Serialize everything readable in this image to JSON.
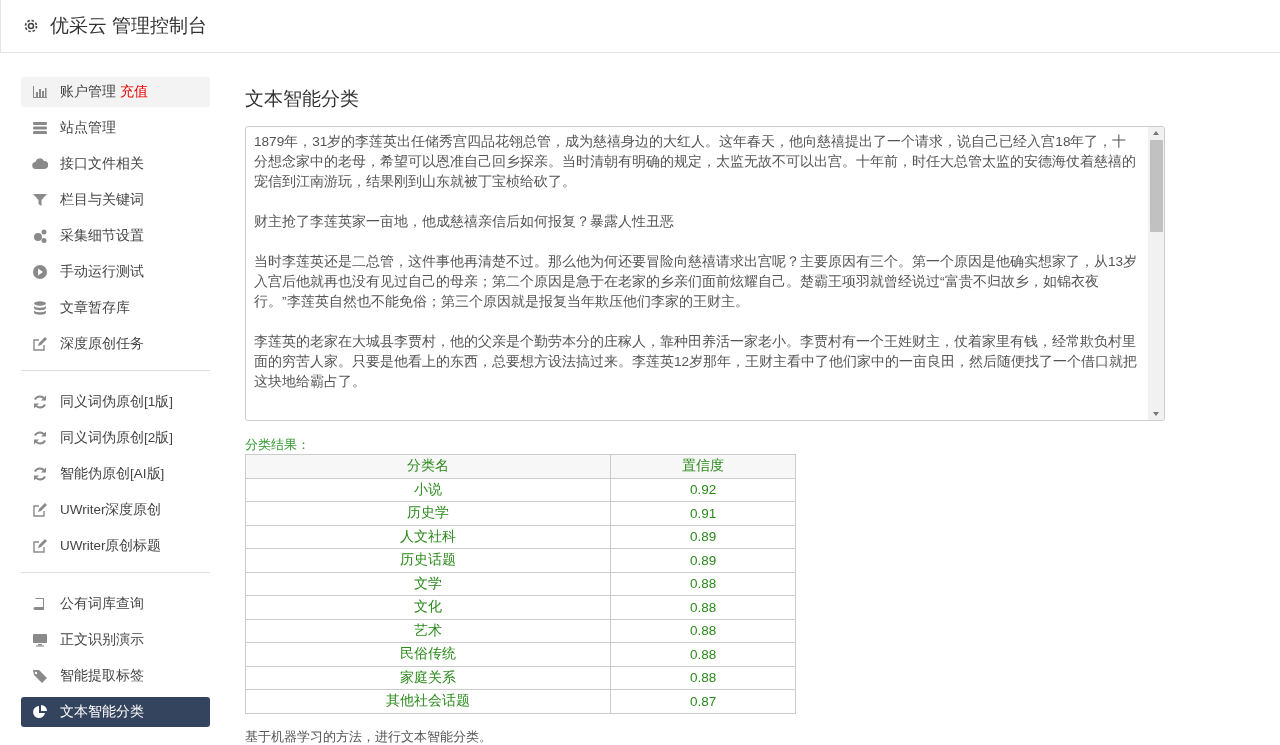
{
  "header": {
    "title": "优采云 管理控制台"
  },
  "sidebar": {
    "groups": [
      {
        "items": [
          {
            "label": "账户管理",
            "badge": "充值",
            "hovered": true,
            "selected": false
          },
          {
            "label": "站点管理",
            "hovered": false,
            "selected": false
          },
          {
            "label": "接口文件相关",
            "hovered": false,
            "selected": false
          },
          {
            "label": "栏目与关键词",
            "hovered": false,
            "selected": false
          },
          {
            "label": "采集细节设置",
            "hovered": false,
            "selected": false
          },
          {
            "label": "手动运行测试",
            "hovered": false,
            "selected": false
          },
          {
            "label": "文章暂存库",
            "hovered": false,
            "selected": false
          },
          {
            "label": "深度原创任务",
            "hovered": false,
            "selected": false
          }
        ]
      },
      {
        "items": [
          {
            "label": "同义词伪原创[1版]",
            "hovered": false,
            "selected": false
          },
          {
            "label": "同义词伪原创[2版]",
            "hovered": false,
            "selected": false
          },
          {
            "label": "智能伪原创[AI版]",
            "hovered": false,
            "selected": false
          },
          {
            "label": "UWriter深度原创",
            "hovered": false,
            "selected": false
          },
          {
            "label": "UWriter原创标题",
            "hovered": false,
            "selected": false
          }
        ]
      },
      {
        "items": [
          {
            "label": "公有词库查询",
            "hovered": false,
            "selected": false
          },
          {
            "label": "正文识别演示",
            "hovered": false,
            "selected": false
          },
          {
            "label": "智能提取标签",
            "hovered": false,
            "selected": false
          },
          {
            "label": "文本智能分类",
            "hovered": false,
            "selected": true
          }
        ]
      }
    ]
  },
  "main": {
    "title": "文本智能分类",
    "input_text": [
      "1879年，31岁的李莲英出任储秀宫四品花翎总管，成为慈禧身边的大红人。这年春天，他向慈禧提出了一个请求，说自己已经入宫18年了，十分想念家中的老母，希望可以恩准自己回乡探亲。当时清朝有明确的规定，太监无故不可以出宫。十年前，时任大总管太监的安德海仗着慈禧的宠信到江南游玩，结果刚到山东就被丁宝桢给砍了。",
      "财主抢了李莲英家一亩地，他成慈禧亲信后如何报复？暴露人性丑恶",
      "当时李莲英还是二总管，这件事他再清楚不过。那么他为何还要冒险向慈禧请求出宫呢？主要原因有三个。第一个原因是他确实想家了，从13岁入宫后他就再也没有见过自己的母亲；第二个原因是急于在老家的乡亲们面前炫耀自己。楚霸王项羽就曾经说过“富贵不归故乡，如锦衣夜行。”李莲英自然也不能免俗；第三个原因就是报复当年欺压他们李家的王财主。",
      "李莲英的老家在大城县李贾村，他的父亲是个勤劳本分的庄稼人，靠种田养活一家老小。李贾村有一个王姓财主，仗着家里有钱，经常欺负村里面的穷苦人家。只要是他看上的东西，总要想方设法搞过来。李莲英12岁那年，王财主看中了他们家中的一亩良田，然后随便找了一个借口就把这块地给霸占了。"
    ],
    "result_label": "分类结果：",
    "table": {
      "columns": [
        "分类名",
        "置信度"
      ],
      "rows": [
        [
          "小说",
          "0.92"
        ],
        [
          "历史学",
          "0.91"
        ],
        [
          "人文社科",
          "0.89"
        ],
        [
          "历史话题",
          "0.89"
        ],
        [
          "文学",
          "0.88"
        ],
        [
          "文化",
          "0.88"
        ],
        [
          "艺术",
          "0.88"
        ],
        [
          "民俗传统",
          "0.88"
        ],
        [
          "家庭关系",
          "0.88"
        ],
        [
          "其他社会话题",
          "0.87"
        ]
      ]
    },
    "footnote": "基于机器学习的方法，进行文本智能分类。"
  }
}
